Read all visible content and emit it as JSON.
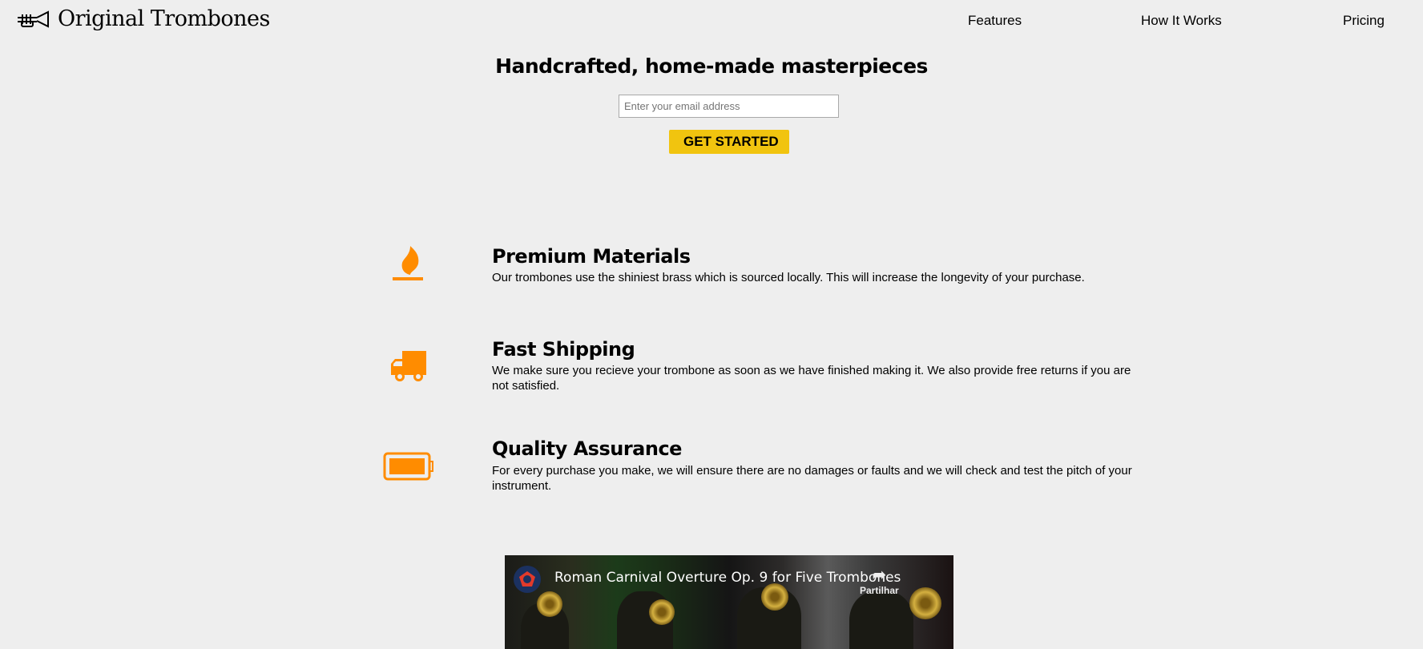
{
  "header": {
    "brand": "Original Trombones",
    "nav": [
      "Features",
      "How It Works",
      "Pricing"
    ]
  },
  "hero": {
    "title": "Handcrafted, home-made masterpieces",
    "email_placeholder": "Enter your email address",
    "cta": "GET STARTED"
  },
  "features": [
    {
      "icon": "flame-icon",
      "title": "Premium Materials",
      "desc": "Our trombones use the shiniest brass which is sourced locally. This will increase the longevity of your purchase."
    },
    {
      "icon": "truck-icon",
      "title": "Fast Shipping",
      "desc": "We make sure you recieve your trombone as soon as we have finished making it. We also provide free returns if you are not satisfied."
    },
    {
      "icon": "battery-icon",
      "title": "Quality Assurance",
      "desc": "For every purchase you make, we will ensure there are no damages or faults and we will check and test the pitch of your instrument."
    }
  ],
  "video": {
    "title": "Roman Carnival Overture Op. 9 for Five Trombones",
    "share": "Partilhar"
  },
  "colors": {
    "accent": "#ff8c00",
    "cta": "#f1c40f",
    "background": "#eeeeee"
  }
}
